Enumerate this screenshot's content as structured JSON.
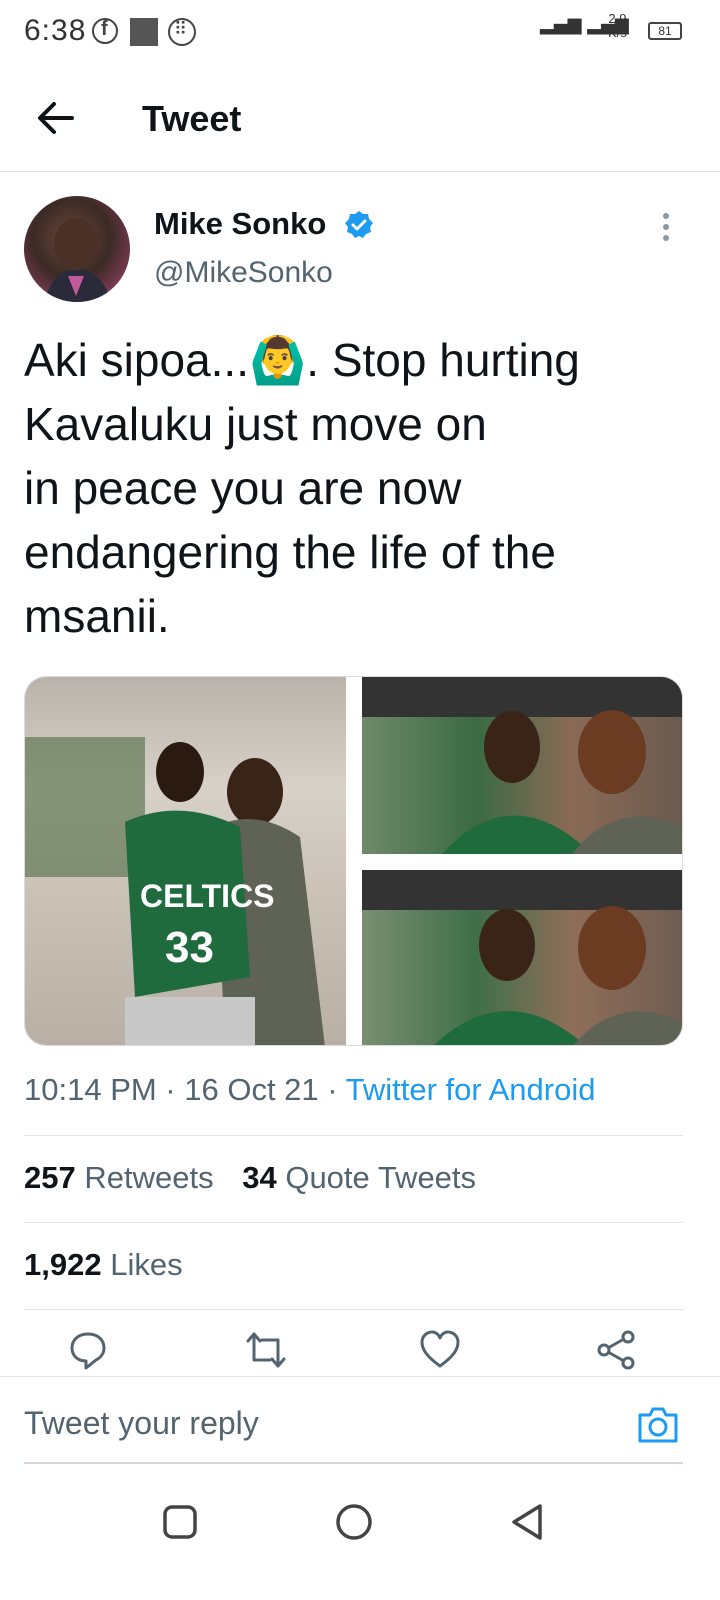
{
  "status_bar": {
    "time": "6:38",
    "network_speed_value": "2.9",
    "network_speed_unit": "K/s",
    "battery": "81",
    "icons": [
      "facebook-icon",
      "image-icon",
      "dots-grid-icon",
      "signal-icon",
      "battery-icon"
    ]
  },
  "header": {
    "title": "Tweet",
    "back_icon": "arrow-left-icon"
  },
  "tweet": {
    "author_name": "Mike Sonko",
    "author_handle": "@MikeSonko",
    "verified": true,
    "text": "Aki sipoa...🙆‍♂️. Stop hurting\nKavaluku just move on\nin peace you are now\nendangering the life of the\nmsanii.",
    "timestamp": "10:14 PM · 16 Oct 21 · ",
    "source": "Twitter for Android"
  },
  "stats": {
    "retweets_count": "257",
    "retweets_label": "Retweets",
    "quotes_count": "34",
    "quotes_label": "Quote Tweets",
    "likes_count": "1,922",
    "likes_label": "Likes"
  },
  "reply": {
    "placeholder": "Tweet your reply"
  },
  "colors": {
    "accent": "#1d9bf0",
    "text": "#0f1419",
    "secondary": "#536471"
  }
}
